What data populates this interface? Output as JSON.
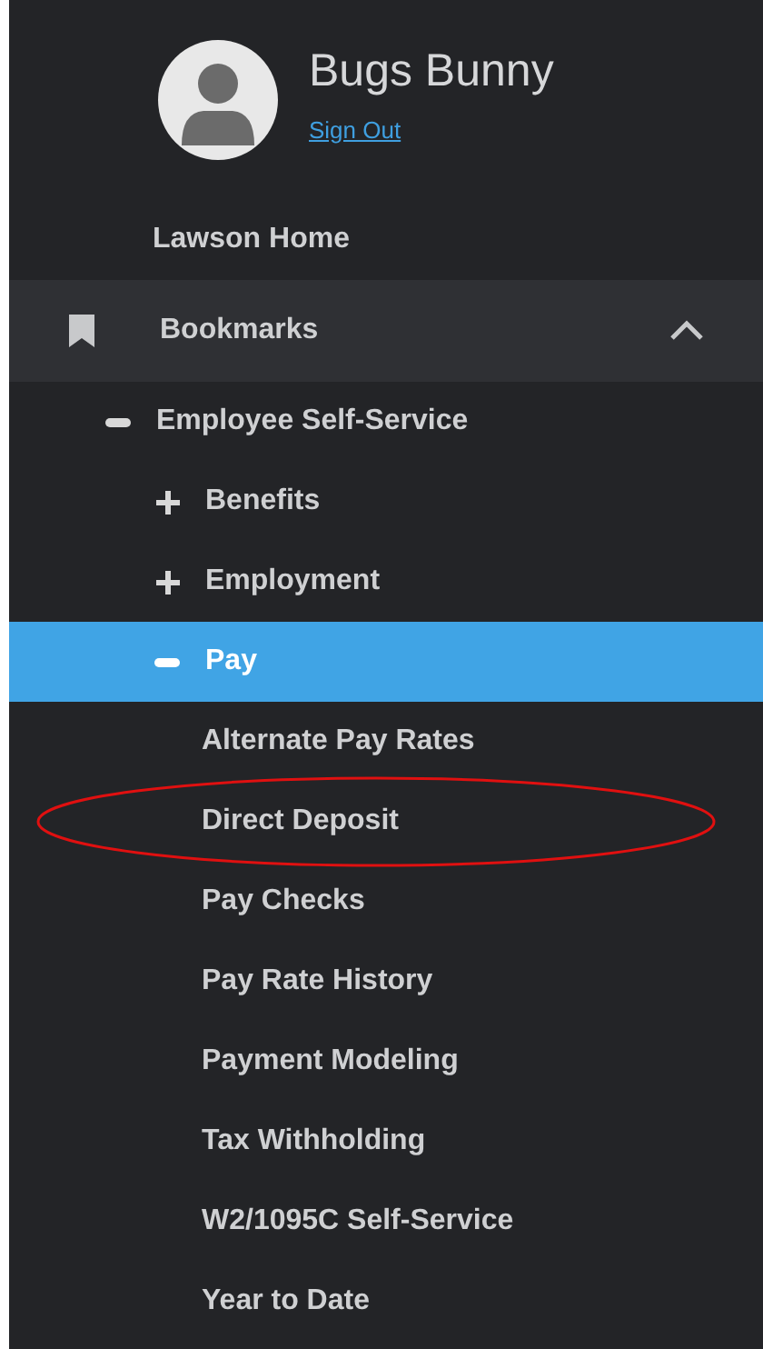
{
  "user": {
    "name": "Bugs Bunny",
    "sign_out": "Sign Out"
  },
  "home_link": "Lawson Home",
  "bookmarks": {
    "label": "Bookmarks",
    "expanded": true
  },
  "tree": [
    {
      "label": "Employee Self-Service",
      "expanded": true,
      "selected": false,
      "children": [
        {
          "label": "Benefits",
          "expanded": false,
          "selected": false
        },
        {
          "label": "Employment",
          "expanded": false,
          "selected": false
        },
        {
          "label": "Pay",
          "expanded": true,
          "selected": true,
          "children": [
            {
              "label": "Alternate Pay Rates",
              "selected": false,
              "circled": false
            },
            {
              "label": "Direct Deposit",
              "selected": false,
              "circled": true
            },
            {
              "label": "Pay Checks",
              "selected": false,
              "circled": false
            },
            {
              "label": "Pay Rate History",
              "selected": false,
              "circled": false
            },
            {
              "label": "Payment Modeling",
              "selected": false,
              "circled": false
            },
            {
              "label": "Tax Withholding",
              "selected": false,
              "circled": false
            },
            {
              "label": "W2/1095C Self-Service",
              "selected": false,
              "circled": false
            },
            {
              "label": "Year to Date",
              "selected": false,
              "circled": false
            }
          ]
        }
      ]
    }
  ]
}
